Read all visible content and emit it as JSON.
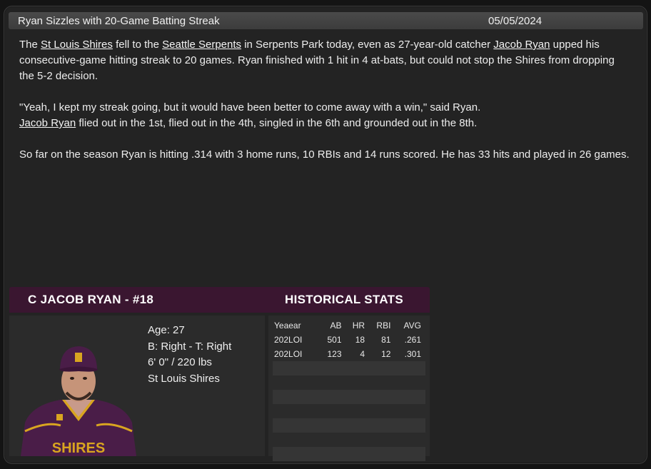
{
  "header": {
    "headline": "Ryan Sizzles with 20-Game Batting Streak",
    "date": "05/05/2024"
  },
  "article": {
    "p1_a": "The ",
    "p1_link1": "St Louis Shires",
    "p1_b": " fell to the ",
    "p1_link2": "Seattle Serpents",
    "p1_c": " in Serpents Park today, even as 27-year-old catcher ",
    "p1_link3": "Jacob Ryan",
    "p1_d": " upped his consecutive-game hitting streak to 20 games.  Ryan finished with 1 hit in 4 at-bats, but could not stop the Shires from dropping the 5-2 decision.",
    "p2_line1": "\"Yeah, I kept my streak going, but it would have been better to come away with a win,\" said Ryan.",
    "p2_link": "Jacob Ryan",
    "p2_rest": " flied out in the 1st, flied out in the 4th, singled in the 6th and grounded out in the 8th.",
    "p3": "So far on the season Ryan is hitting .314 with 3 home runs, 10 RBIs and 14 runs scored. He has 33 hits and played in 26 games."
  },
  "player_card": {
    "title": "C JACOB RYAN - #18",
    "age": "Age: 27",
    "bats_throws": "B: Right - T: Right",
    "height_weight": "6' 0\" / 220 lbs",
    "team": "St Louis Shires",
    "jersey_text": "SHIRES"
  },
  "historical_stats": {
    "title": "HISTORICAL STATS",
    "columns": [
      "Yea",
      "ear",
      "AB",
      "HR",
      "RBI",
      "AVG"
    ],
    "rows": [
      {
        "year": "202",
        "team": "LOI",
        "ab": "501",
        "hr": "18",
        "rbi": "81",
        "avg": ".261"
      },
      {
        "year": "202",
        "team": "LOI",
        "ab": "123",
        "hr": "4",
        "rbi": "12",
        "avg": ".301"
      }
    ]
  },
  "colors": {
    "header_band": "#3a1630",
    "panel": "#2b2b2b",
    "jersey": "#4a1d48",
    "gold": "#d9a520"
  }
}
